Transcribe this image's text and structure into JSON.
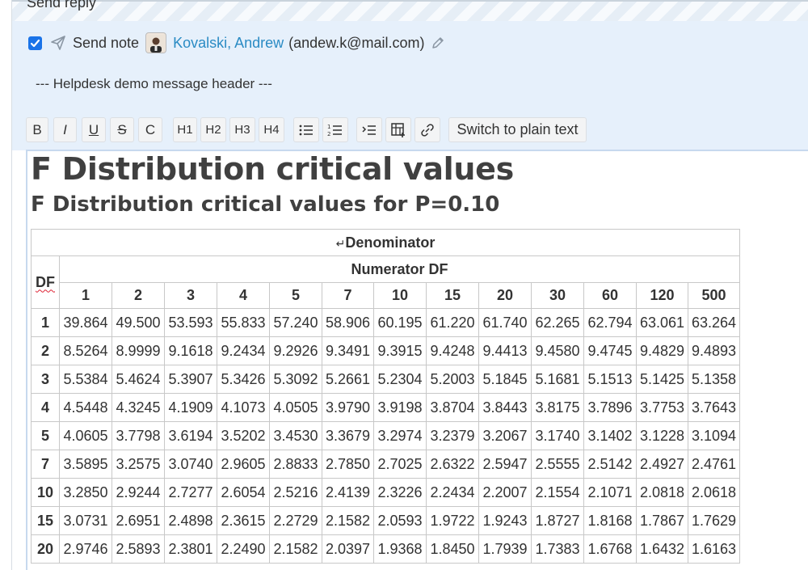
{
  "reply": {
    "title": "Send reply"
  },
  "note": {
    "checked": true,
    "label": "Send note",
    "contact_name": "Kovalski, Andrew",
    "contact_email": "(andew.k@mail.com)"
  },
  "message_header": "--- Helpdesk demo message header ---",
  "toolbar": {
    "bold": "B",
    "italic": "I",
    "underline": "U",
    "strike": "S",
    "clear": "C",
    "h1": "H1",
    "h2": "H2",
    "h3": "H3",
    "h4": "H4",
    "plain_text": "Switch to plain text"
  },
  "document": {
    "title": "F Distribution critical values",
    "subtitle": "F Distribution critical values for P=0.10",
    "table": {
      "denominator_label": "Denominator",
      "df_label": "DF",
      "numerator_label": "Numerator DF",
      "columns": [
        "1",
        "2",
        "3",
        "4",
        "5",
        "7",
        "10",
        "15",
        "20",
        "30",
        "60",
        "120",
        "500"
      ],
      "rows": [
        {
          "df": "1",
          "values": [
            "39.864",
            "49.500",
            "53.593",
            "55.833",
            "57.240",
            "58.906",
            "60.195",
            "61.220",
            "61.740",
            "62.265",
            "62.794",
            "63.061",
            "63.264"
          ]
        },
        {
          "df": "2",
          "values": [
            "8.5264",
            "8.9999",
            "9.1618",
            "9.2434",
            "9.2926",
            "9.3491",
            "9.3915",
            "9.4248",
            "9.4413",
            "9.4580",
            "9.4745",
            "9.4829",
            "9.4893"
          ]
        },
        {
          "df": "3",
          "values": [
            "5.5384",
            "5.4624",
            "5.3907",
            "5.3426",
            "5.3092",
            "5.2661",
            "5.2304",
            "5.2003",
            "5.1845",
            "5.1681",
            "5.1513",
            "5.1425",
            "5.1358"
          ]
        },
        {
          "df": "4",
          "values": [
            "4.5448",
            "4.3245",
            "4.1909",
            "4.1073",
            "4.0505",
            "3.9790",
            "3.9198",
            "3.8704",
            "3.8443",
            "3.8175",
            "3.7896",
            "3.7753",
            "3.7643"
          ]
        },
        {
          "df": "5",
          "values": [
            "4.0605",
            "3.7798",
            "3.6194",
            "3.5202",
            "3.4530",
            "3.3679",
            "3.2974",
            "3.2379",
            "3.2067",
            "3.1740",
            "3.1402",
            "3.1228",
            "3.1094"
          ]
        },
        {
          "df": "7",
          "values": [
            "3.5895",
            "3.2575",
            "3.0740",
            "2.9605",
            "2.8833",
            "2.7850",
            "2.7025",
            "2.6322",
            "2.5947",
            "2.5555",
            "2.5142",
            "2.4927",
            "2.4761"
          ]
        },
        {
          "df": "10",
          "values": [
            "3.2850",
            "2.9244",
            "2.7277",
            "2.6054",
            "2.5216",
            "2.4139",
            "2.3226",
            "2.2434",
            "2.2007",
            "2.1554",
            "2.1071",
            "2.0818",
            "2.0618"
          ]
        },
        {
          "df": "15",
          "values": [
            "3.0731",
            "2.6951",
            "2.4898",
            "2.3615",
            "2.2729",
            "2.1582",
            "2.0593",
            "1.9722",
            "1.9243",
            "1.8727",
            "1.8168",
            "1.7867",
            "1.7629"
          ]
        },
        {
          "df": "20",
          "values": [
            "2.9746",
            "2.5893",
            "2.3801",
            "2.2490",
            "2.1582",
            "2.0397",
            "1.9368",
            "1.8450",
            "1.7939",
            "1.7383",
            "1.6768",
            "1.6432",
            "1.6163"
          ]
        }
      ]
    }
  },
  "colors": {
    "panel_bg": "#e6f0fb",
    "link": "#2a8bc4",
    "checkbox": "#1a73e8"
  },
  "icons": [
    "send-icon",
    "pencil-icon",
    "bullet-list-icon",
    "numbered-list-icon",
    "indent-icon",
    "table-icon",
    "link-icon"
  ]
}
